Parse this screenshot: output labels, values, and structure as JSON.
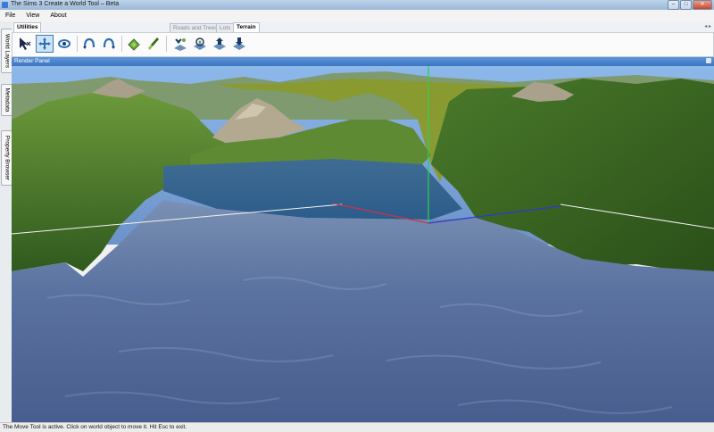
{
  "window": {
    "title": "The Sims 3 Create a World Tool – Beta",
    "buttons": [
      "–",
      "□",
      "✕"
    ]
  },
  "menu": [
    "File",
    "View",
    "About"
  ],
  "side_tabs": [
    "World Layers",
    "Metadata",
    "Property Browser"
  ],
  "tabs": [
    {
      "label": "Utilities",
      "active": true
    },
    {
      "label": "Roads and Trees",
      "active": false
    },
    {
      "label": "Lots",
      "active": false
    },
    {
      "label": "Terrain",
      "active": true
    }
  ],
  "tab_nav": "◂ ▸",
  "toolbar_icons": [
    "select-arrow-icon",
    "move-tool-icon",
    "rotate-camera-icon",
    "arc-left-icon",
    "arc-right-icon",
    "terrain-paint-icon",
    "terrain-brush-icon",
    "terrain-sculpt-icon",
    "terrain-smooth-icon",
    "terrain-raise-icon",
    "terrain-lower-icon"
  ],
  "render_panel": {
    "title": "Render Panel"
  },
  "status": "The Move Tool is active. Click on world object to move it. Hit Esc to exit.",
  "colors": {
    "water": "#556e9c",
    "grass": "#4f7a2c",
    "sky": "#86b2e6",
    "accent": "#3d74bf"
  }
}
